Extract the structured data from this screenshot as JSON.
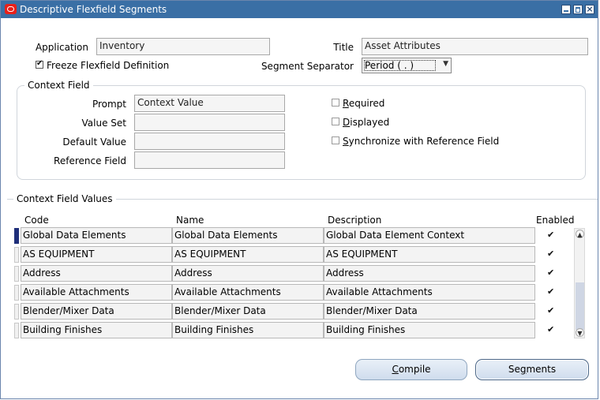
{
  "window": {
    "title": "Descriptive Flexfield Segments"
  },
  "header": {
    "application_label": "Application",
    "application_value": "Inventory",
    "title_label": "Title",
    "title_value": "Asset Attributes",
    "freeze_label": "Freeze Flexfield Definition",
    "freeze_checked": true,
    "separator_label": "Segment Separator",
    "separator_value": "Period ( . )"
  },
  "context_field": {
    "group_title": "Context Field",
    "prompt_label": "Prompt",
    "prompt_value": "Context Value",
    "value_set_label": "Value Set",
    "value_set_value": "",
    "default_value_label": "Default Value",
    "default_value_value": "",
    "reference_field_label": "Reference Field",
    "reference_field_value": "",
    "required_label": "Required",
    "required_checked": false,
    "displayed_label": "Displayed",
    "displayed_checked": false,
    "sync_label": "Synchronize with Reference Field",
    "sync_checked": false
  },
  "context_values": {
    "group_title": "Context Field Values",
    "columns": {
      "code": "Code",
      "name": "Name",
      "description": "Description",
      "enabled": "Enabled"
    },
    "rows": [
      {
        "code": "Global Data Elements",
        "name": "Global Data Elements",
        "description": "Global Data Element Context",
        "enabled": true,
        "current": true
      },
      {
        "code": "AS EQUIPMENT",
        "name": "AS EQUIPMENT",
        "description": "AS EQUIPMENT",
        "enabled": true,
        "current": false
      },
      {
        "code": "Address",
        "name": "Address",
        "description": "Address",
        "enabled": true,
        "current": false
      },
      {
        "code": "Available Attachments",
        "name": "Available Attachments",
        "description": "Available Attachments",
        "enabled": true,
        "current": false
      },
      {
        "code": "Blender/Mixer Data",
        "name": "Blender/Mixer Data",
        "description": "Blender/Mixer Data",
        "enabled": true,
        "current": false
      },
      {
        "code": "Building Finishes",
        "name": "Building Finishes",
        "description": "Building Finishes",
        "enabled": true,
        "current": false
      }
    ]
  },
  "buttons": {
    "compile": "Compile",
    "segments": "Segments"
  },
  "colors": {
    "titlebar": "#3a6fa5",
    "current_row_indicator": "#1f2f7a",
    "oracle_icon": "#e8201a"
  }
}
